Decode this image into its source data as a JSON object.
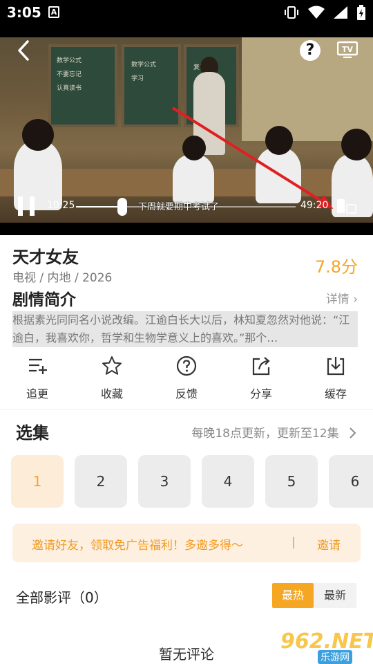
{
  "status_bar": {
    "time": "3:05",
    "a_icon": "A"
  },
  "player": {
    "current_time": "10:25",
    "total_time": "49:20",
    "progress": 0.21,
    "subtitle": "下周就要期中考试了",
    "help_label": "?",
    "icons": [
      "back-icon",
      "help-icon",
      "tv-cast-icon",
      "pause-icon",
      "fullscreen-icon"
    ],
    "annotation_color": "#e02020",
    "chalkboard_text": [
      "数学公式",
      "学习",
      "复习",
      "不要忘记",
      "认真读书"
    ]
  },
  "info": {
    "title": "天才女友",
    "meta": "电视 / 内地 / 2026",
    "score": "7.8分",
    "synopsis_title": "剧情简介",
    "detail_link": "详情 ›",
    "synopsis": "根据素光同同名小说改编。江逾白长大以后，林知夏忽然对他说：“江逾白，我喜欢你，哲学和生物学意义上的喜欢。”那个…"
  },
  "actions": [
    {
      "label": "追更",
      "icon": "follow-list-icon"
    },
    {
      "label": "收藏",
      "icon": "star-icon"
    },
    {
      "label": "反馈",
      "icon": "question-icon"
    },
    {
      "label": "分享",
      "icon": "share-icon"
    },
    {
      "label": "缓存",
      "icon": "download-icon"
    }
  ],
  "episodes": {
    "title": "选集",
    "note": "每晚18点更新，更新至12集",
    "items": [
      "1",
      "2",
      "3",
      "4",
      "5",
      "6"
    ],
    "selected": "1"
  },
  "invite": {
    "text": "邀请好友，领取免广告福利！多邀多得～",
    "separator": "|",
    "button": "邀请"
  },
  "reviews": {
    "title": "全部影评（0）",
    "sort_hot": "最热",
    "sort_new": "最新",
    "empty": "暂无评论"
  },
  "watermark": {
    "number": "962.NET",
    "site": "乐游网"
  },
  "colors": {
    "accent": "#f5a623",
    "invite_bg": "#fdf0e0"
  }
}
